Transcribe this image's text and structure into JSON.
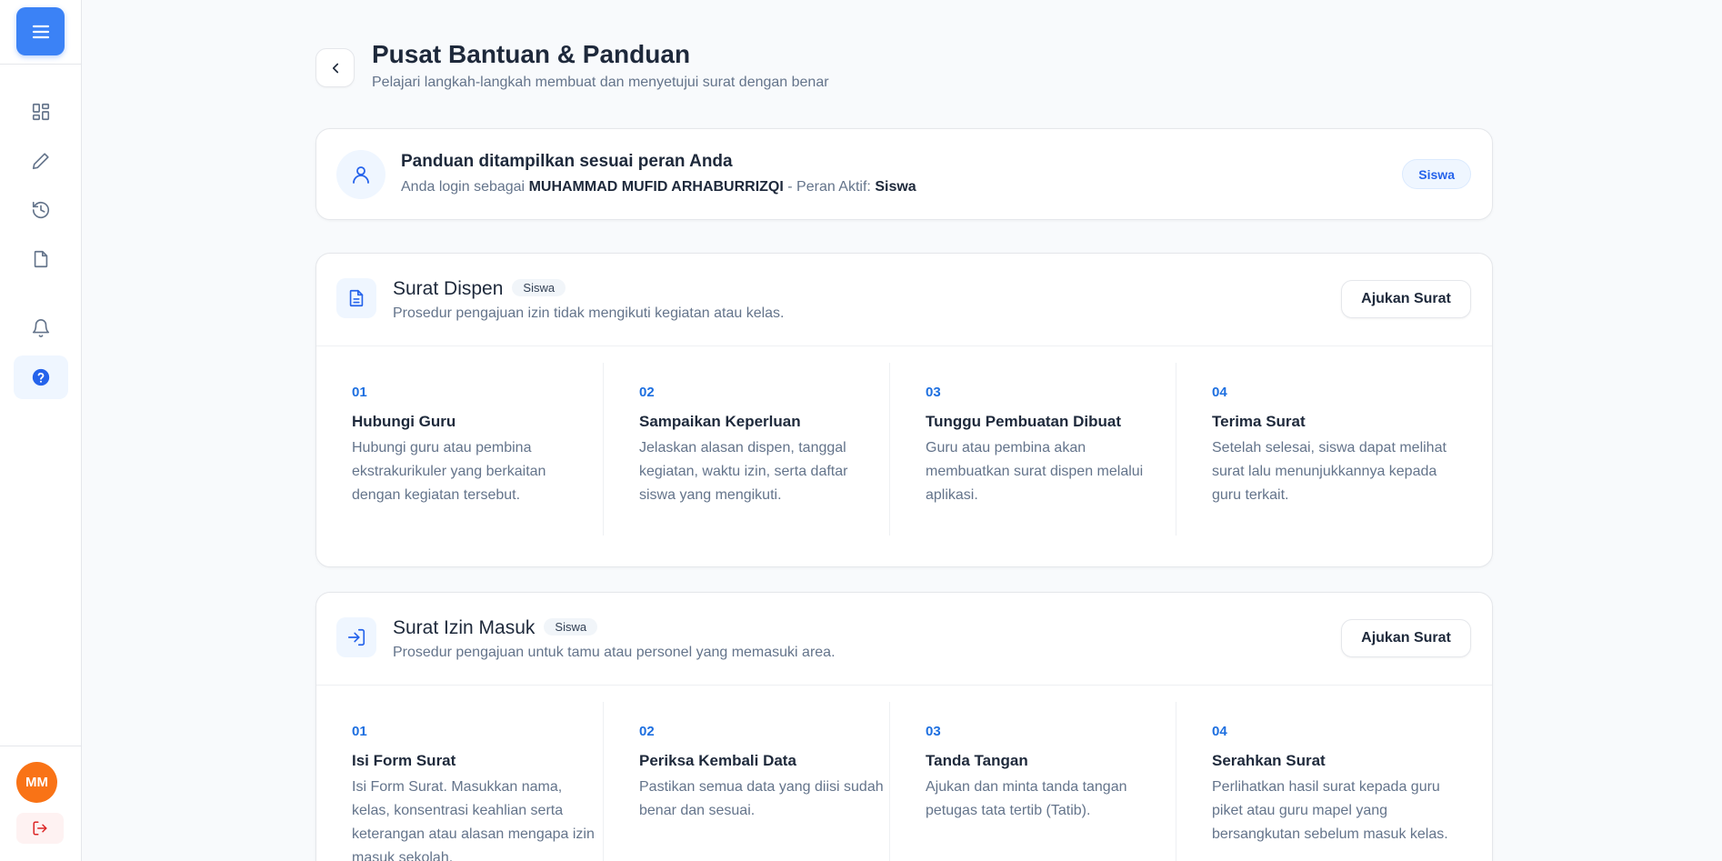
{
  "header": {
    "title": "Pusat Bantuan & Panduan",
    "subtitle": "Pelajari langkah-langkah membuat dan menyetujui surat dengan benar"
  },
  "user": {
    "initials": "MM"
  },
  "role_card": {
    "title": "Panduan ditampilkan sesuai peran Anda",
    "prefix": "Anda login sebagai",
    "name": "MUHAMMAD MUFID ARHABURRIZQI",
    "role_prefix": " - Peran Aktif:",
    "role": "Siswa",
    "badge": "Siswa"
  },
  "sections": [
    {
      "title": "Surat Dispen",
      "badge": "Siswa",
      "description": "Prosedur pengajuan izin tidak mengikuti kegiatan atau kelas.",
      "button": "Ajukan Surat",
      "steps": [
        {
          "num": "01",
          "title": "Hubungi Guru",
          "desc": "Hubungi guru atau pembina ekstrakurikuler yang berkaitan dengan kegiatan tersebut."
        },
        {
          "num": "02",
          "title": "Sampaikan Keperluan",
          "desc": "Jelaskan alasan dispen, tanggal kegiatan, waktu izin, serta daftar siswa yang mengikuti."
        },
        {
          "num": "03",
          "title": "Tunggu Pembuatan Dibuat",
          "desc": "Guru atau pembina akan membuatkan surat dispen melalui aplikasi."
        },
        {
          "num": "04",
          "title": "Terima Surat",
          "desc": "Setelah selesai, siswa dapat melihat surat lalu menunjukkannya kepada guru terkait."
        }
      ]
    },
    {
      "title": "Surat Izin Masuk",
      "badge": "Siswa",
      "description": "Prosedur pengajuan untuk tamu atau personel yang memasuki area.",
      "button": "Ajukan Surat",
      "steps": [
        {
          "num": "01",
          "title": "Isi Form Surat",
          "desc": "Isi Form Surat. Masukkan nama, kelas, konsentrasi keahlian serta keterangan atau alasan mengapa izin masuk sekolah."
        },
        {
          "num": "02",
          "title": "Periksa Kembali Data",
          "desc": "Pastikan semua data yang diisi sudah benar dan sesuai."
        },
        {
          "num": "03",
          "title": "Tanda Tangan",
          "desc": "Ajukan dan minta tanda tangan petugas tata tertib (Tatib)."
        },
        {
          "num": "04",
          "title": "Serahkan Surat",
          "desc": "Perlihatkan hasil surat kepada guru piket atau guru mapel yang bersangkutan sebelum masuk kelas."
        }
      ]
    }
  ],
  "colors": {
    "accent": "#3b82f6",
    "step_number": "#1d6fe0",
    "avatar": "#f97316",
    "logout": "#dc2626"
  }
}
